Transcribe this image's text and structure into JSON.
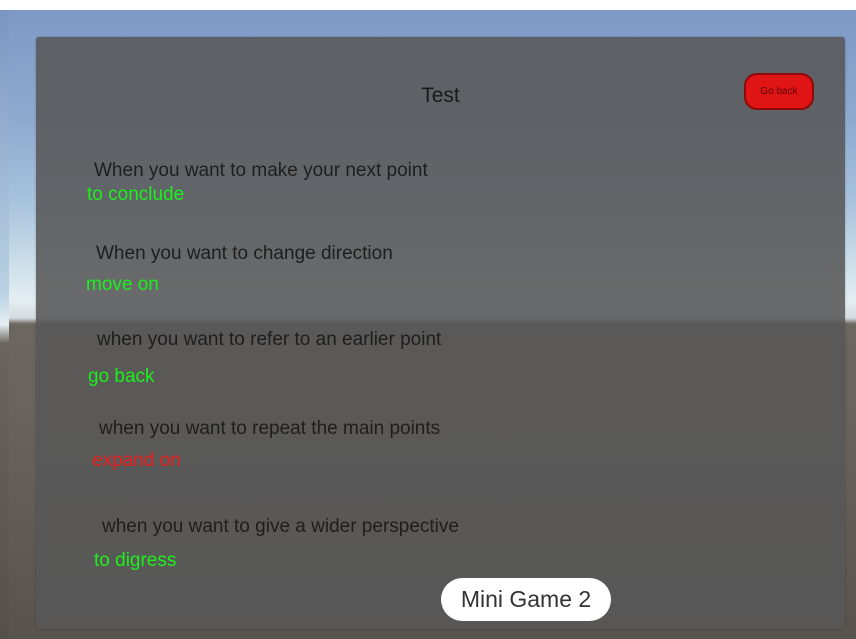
{
  "panel": {
    "title": "Test",
    "go_back_label": "Go back"
  },
  "items": [
    {
      "prompt": "When you want to make your next point",
      "answer": "to conclude",
      "status": "correct"
    },
    {
      "prompt": "When you want to change direction",
      "answer": "move on",
      "status": "correct"
    },
    {
      "prompt": "when you want to refer to an earlier point",
      "answer": "go back",
      "status": "correct"
    },
    {
      "prompt": "when you want to repeat the main points",
      "answer": "expand on",
      "status": "wrong"
    },
    {
      "prompt": "when you want to give a wider perspective",
      "answer": "to digress",
      "status": "correct"
    }
  ],
  "footer": {
    "mini_game_label": "Mini Game 2"
  },
  "colors": {
    "correct": "#1cf01c",
    "wrong": "#ea1c1c",
    "go_back_button": "#e01414",
    "panel": "#585858"
  }
}
